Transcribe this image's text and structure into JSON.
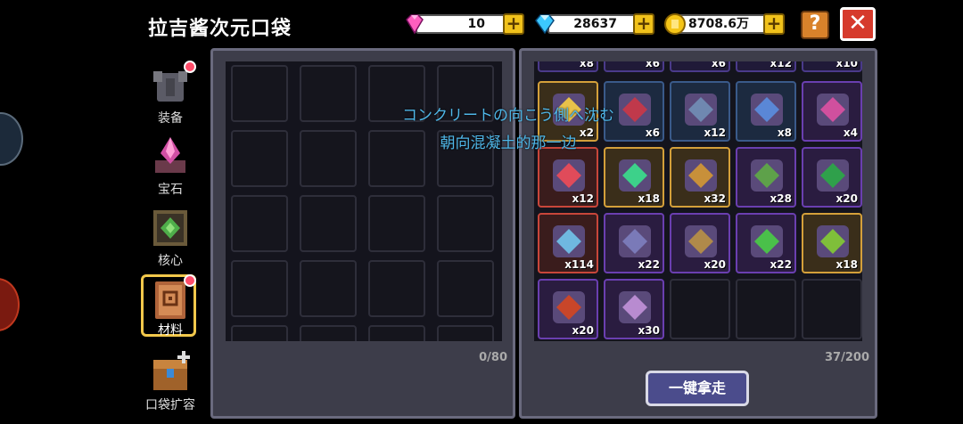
{
  "header": {
    "title": "拉吉酱次元口袋"
  },
  "currencies": [
    {
      "icon": "pink-gem-icon",
      "value": "10"
    },
    {
      "icon": "blue-diamond-icon",
      "value": "28637"
    },
    {
      "icon": "gold-coin-icon",
      "value": "8708.6万"
    }
  ],
  "buttons": {
    "help": "?",
    "close": "✕",
    "take_all": "一键拿走"
  },
  "sidebar": [
    {
      "label": "装备",
      "icon": "armor-icon",
      "badge": true
    },
    {
      "label": "宝石",
      "icon": "gem-crystal-icon",
      "badge": false
    },
    {
      "label": "核心",
      "icon": "core-icon",
      "badge": false
    },
    {
      "label": "材料",
      "icon": "material-book-icon",
      "badge": true,
      "selected": true
    },
    {
      "label": "口袋扩容",
      "icon": "chest-expand-icon",
      "badge": false
    }
  ],
  "pocket": {
    "capacity": "0/80"
  },
  "storage": {
    "capacity": "37/200",
    "top_counts": [
      "x8",
      "x6",
      "x6",
      "x12",
      "x10"
    ],
    "items": [
      {
        "name": "item-glove",
        "count": "x2",
        "rarity": "gold",
        "color": "#e8c14a"
      },
      {
        "name": "item-red-feather",
        "count": "x6",
        "rarity": "blue",
        "color": "#c0394b"
      },
      {
        "name": "item-spear-tip",
        "count": "x12",
        "rarity": "blue",
        "color": "#6f88b0"
      },
      {
        "name": "item-blue-tool",
        "count": "x8",
        "rarity": "blue",
        "color": "#5a87d6"
      },
      {
        "name": "item-pink-slime",
        "count": "x4",
        "rarity": "purple",
        "color": "#d0509e"
      },
      {
        "name": "item-red-shard",
        "count": "x12",
        "rarity": "red",
        "color": "#e04b5a"
      },
      {
        "name": "item-green-orb",
        "count": "x18",
        "rarity": "gold",
        "color": "#3dd18a"
      },
      {
        "name": "item-pickaxe",
        "count": "x32",
        "rarity": "gold",
        "color": "#c8903a"
      },
      {
        "name": "item-cactus",
        "count": "x28",
        "rarity": "purple",
        "color": "#5ea14a"
      },
      {
        "name": "item-green-chip",
        "count": "x20",
        "rarity": "purple",
        "color": "#2fa04b"
      },
      {
        "name": "item-magic-ring",
        "count": "x114",
        "rarity": "red",
        "color": "#6fb8e0"
      },
      {
        "name": "item-gear-blade",
        "count": "x22",
        "rarity": "purple",
        "color": "#7a7ab8"
      },
      {
        "name": "item-bell",
        "count": "x20",
        "rarity": "purple",
        "color": "#b08a4a"
      },
      {
        "name": "item-green-slime",
        "count": "x22",
        "rarity": "purple",
        "color": "#4ac04a"
      },
      {
        "name": "item-green-scroll",
        "count": "x18",
        "rarity": "gold",
        "color": "#7fbf3a"
      },
      {
        "name": "item-red-orb",
        "count": "x20",
        "rarity": "purple",
        "color": "#c8462a"
      },
      {
        "name": "item-bone-shell",
        "count": "x30",
        "rarity": "purple",
        "color": "#b88bd0"
      }
    ]
  },
  "subtitles": {
    "japanese": "コンクリートの向こう側へ沈む",
    "chinese": "朝向混凝土的那一边"
  }
}
